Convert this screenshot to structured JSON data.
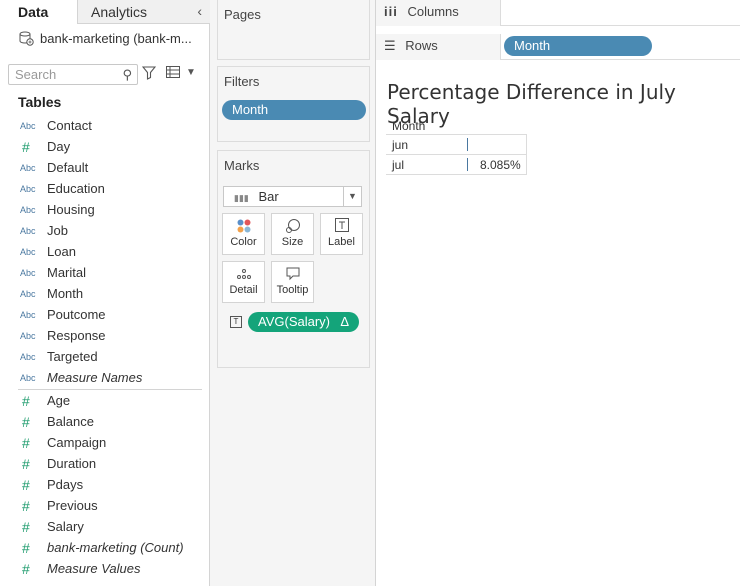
{
  "data_pane": {
    "tab_data": "Data",
    "tab_analytics": "Analytics",
    "datasource": "bank-marketing (bank-m...",
    "search_placeholder": "Search",
    "tables_title": "Tables",
    "dimensions": [
      {
        "type": "Abc",
        "name": "Contact"
      },
      {
        "type": "#",
        "name": "Day"
      },
      {
        "type": "Abc",
        "name": "Default"
      },
      {
        "type": "Abc",
        "name": "Education"
      },
      {
        "type": "Abc",
        "name": "Housing"
      },
      {
        "type": "Abc",
        "name": "Job"
      },
      {
        "type": "Abc",
        "name": "Loan"
      },
      {
        "type": "Abc",
        "name": "Marital"
      },
      {
        "type": "Abc",
        "name": "Month"
      },
      {
        "type": "Abc",
        "name": "Poutcome"
      },
      {
        "type": "Abc",
        "name": "Response"
      },
      {
        "type": "Abc",
        "name": "Targeted"
      },
      {
        "type": "Abc",
        "name": "Measure Names"
      }
    ],
    "measures": [
      {
        "type": "#",
        "name": "Age"
      },
      {
        "type": "#",
        "name": "Balance"
      },
      {
        "type": "#",
        "name": "Campaign"
      },
      {
        "type": "#",
        "name": "Duration"
      },
      {
        "type": "#",
        "name": "Pdays"
      },
      {
        "type": "#",
        "name": "Previous"
      },
      {
        "type": "#",
        "name": "Salary"
      },
      {
        "type": "#",
        "name": "bank-marketing (Count)"
      },
      {
        "type": "#",
        "name": "Measure Values"
      }
    ]
  },
  "shelves": {
    "pages": "Pages",
    "filters": "Filters",
    "filter_pill": "Month",
    "marks": "Marks",
    "mark_type": "Bar",
    "mark_buttons": {
      "color": "Color",
      "size": "Size",
      "label": "Label",
      "detail": "Detail",
      "tooltip": "Tooltip"
    },
    "measure_pill": "AVG(Salary)",
    "measure_pill_delta": "Δ",
    "columns": "Columns",
    "rows": "Rows",
    "rows_pill": "Month"
  },
  "view": {
    "title": "Percentage Difference in July Salary",
    "column_header": "Month",
    "rows": [
      {
        "label": "jun",
        "value": ""
      },
      {
        "label": "jul",
        "value": "8.085%"
      }
    ]
  },
  "colors": {
    "pill_blue": "#4a8ab3",
    "pill_green": "#14a47a"
  }
}
